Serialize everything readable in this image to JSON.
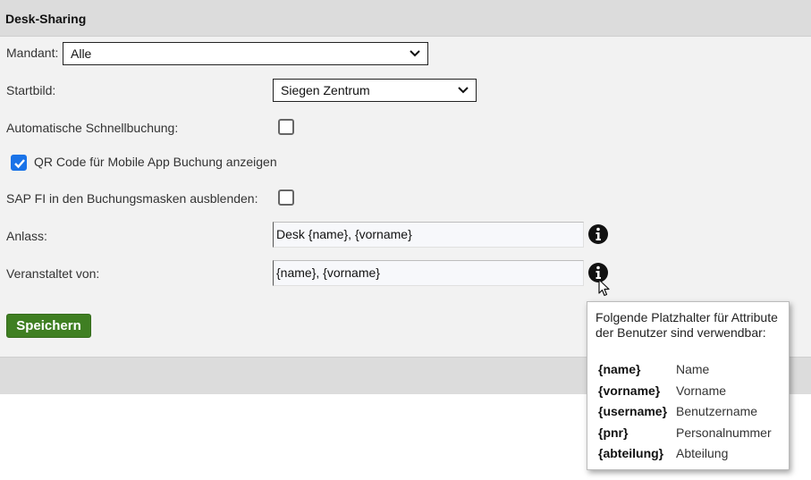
{
  "title": "Desk-Sharing",
  "mandant": {
    "label": "Mandant:",
    "value": "Alle"
  },
  "startbild": {
    "label": "Startbild:",
    "value": "Siegen Zentrum"
  },
  "auto_schnellbuchung": {
    "label": "Automatische Schnellbuchung:",
    "checked": false
  },
  "qr_code": {
    "label": "QR Code für Mobile App Buchung anzeigen",
    "checked": true
  },
  "sap_fi": {
    "label": "SAP FI in den Buchungsmasken ausblenden:",
    "checked": false
  },
  "anlass": {
    "label": "Anlass:",
    "value": "Desk {name}, {vorname}"
  },
  "veranstaltet_von": {
    "label": "Veranstaltet von:",
    "value": "{name}, {vorname}"
  },
  "save_button": "Speichern",
  "tooltip": {
    "heading": "Folgende Platzhalter für Attribute der Benutzer sind verwendbar:",
    "placeholders": [
      {
        "key": "{name}",
        "value": "Name"
      },
      {
        "key": "{vorname}",
        "value": "Vorname"
      },
      {
        "key": "{username}",
        "value": "Benutzername"
      },
      {
        "key": "{pnr}",
        "value": "Personalnummer"
      },
      {
        "key": "{abteilung}",
        "value": "Abteilung"
      }
    ]
  },
  "colors": {
    "accent": "#1a73e8",
    "button": "#3f7f22"
  },
  "icons": [
    "chevron-down-icon",
    "checkmark-icon",
    "info-icon",
    "mouse-cursor-icon"
  ]
}
